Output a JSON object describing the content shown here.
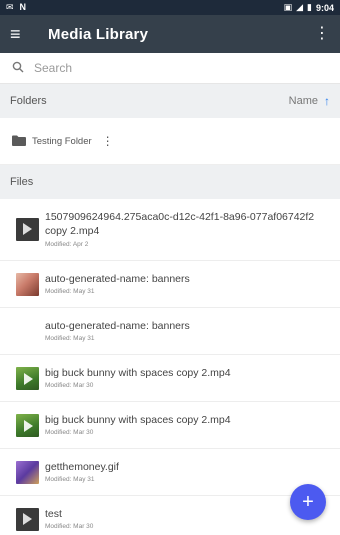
{
  "status_bar": {
    "left_icons": [
      "notification-icon",
      "n-icon"
    ],
    "time": "9:04",
    "right_icons": [
      "no-sim-icon",
      "signal-icon",
      "battery-icon"
    ]
  },
  "app_bar": {
    "title": "Media Library",
    "menu_icon": "menu-icon",
    "overflow_icon": "more-vert-icon"
  },
  "search": {
    "placeholder": "Search",
    "icon": "search-icon"
  },
  "folders_section": {
    "label": "Folders",
    "sort_label": "Name",
    "sort_icon": "arrow-up-icon"
  },
  "folders": [
    {
      "name": "Testing Folder"
    }
  ],
  "files_section": {
    "label": "Files"
  },
  "files": [
    {
      "name": "1507909624964.275aca0c-d12c-42f1-8a96-077af06742f2 copy 2.mp4",
      "modified": "Modified: Apr 2",
      "thumb": "video-dark"
    },
    {
      "name": "auto-generated-name: banners",
      "modified": "Modified: May 31",
      "thumb": "banner"
    },
    {
      "name": "auto-generated-name: banners",
      "modified": "Modified: May 31",
      "thumb": "none"
    },
    {
      "name": "big buck bunny with spaces copy 2.mp4",
      "modified": "Modified: Mar 30",
      "thumb": "bunny"
    },
    {
      "name": "big buck bunny with spaces copy 2.mp4",
      "modified": "Modified: Mar 30",
      "thumb": "bunny"
    },
    {
      "name": "getthemoney.gif",
      "modified": "Modified: May 31",
      "thumb": "gif"
    },
    {
      "name": "test",
      "modified": "Modified: Mar 30",
      "thumb": "video-dark"
    }
  ],
  "fab": {
    "label": "+",
    "icon": "add-icon"
  },
  "colors": {
    "status_bar": "#1e2a3a",
    "app_bar": "#35404b",
    "section_bg": "#eef0f2",
    "accent": "#2f80ed",
    "fab": "#4c5af0"
  }
}
